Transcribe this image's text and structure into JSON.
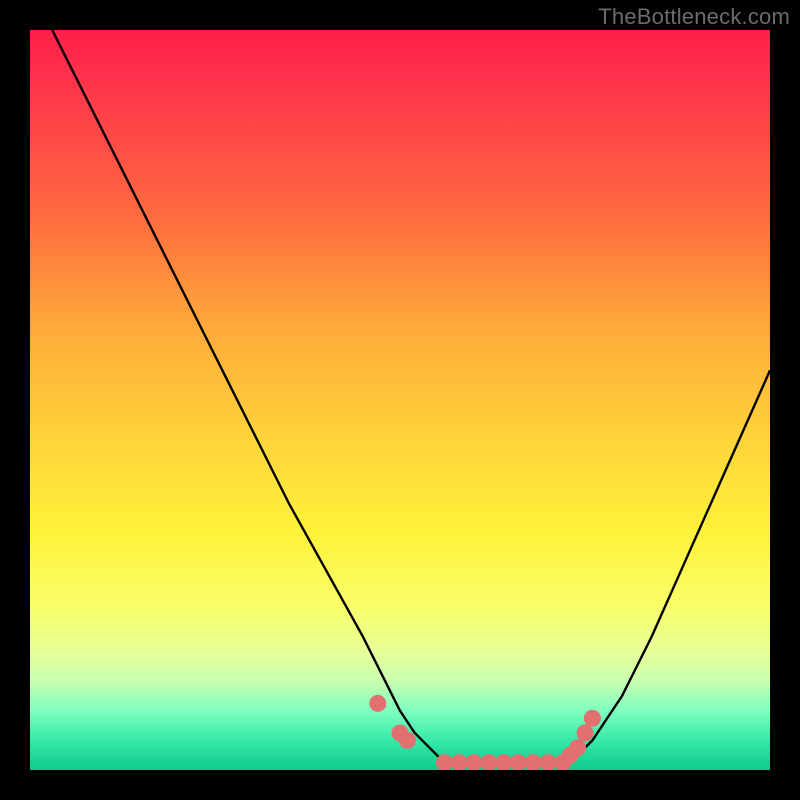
{
  "watermark": "TheBottleneck.com",
  "colors": {
    "background": "#000000",
    "curve_stroke": "#000000",
    "marker_fill": "#e27070",
    "marker_stroke": "#e27070"
  },
  "chart_data": {
    "type": "line",
    "title": "",
    "xlabel": "",
    "ylabel": "",
    "xlim": [
      0,
      100
    ],
    "ylim": [
      0,
      100
    ],
    "grid": false,
    "annotations": [
      "TheBottleneck.com"
    ],
    "series": [
      {
        "name": "bottleneck-curve-left",
        "x": [
          3,
          6,
          10,
          15,
          20,
          25,
          30,
          35,
          40,
          45,
          48,
          50,
          52,
          54,
          56
        ],
        "y": [
          100,
          94,
          86,
          76,
          66,
          56,
          46,
          36,
          27,
          18,
          12,
          8,
          5,
          3,
          1
        ]
      },
      {
        "name": "bottleneck-curve-right",
        "x": [
          73,
          76,
          80,
          84,
          88,
          92,
          96,
          100
        ],
        "y": [
          1,
          4,
          10,
          18,
          27,
          36,
          45,
          54
        ]
      }
    ],
    "flat_segment": {
      "x_start": 56,
      "x_end": 73,
      "y": 1
    },
    "markers": {
      "name": "highlighted-points",
      "points": [
        {
          "x": 47,
          "y": 9
        },
        {
          "x": 50,
          "y": 5
        },
        {
          "x": 51,
          "y": 4
        },
        {
          "x": 56,
          "y": 1
        },
        {
          "x": 58,
          "y": 1
        },
        {
          "x": 60,
          "y": 1
        },
        {
          "x": 62,
          "y": 1
        },
        {
          "x": 64,
          "y": 1
        },
        {
          "x": 66,
          "y": 1
        },
        {
          "x": 68,
          "y": 1
        },
        {
          "x": 70,
          "y": 1
        },
        {
          "x": 72,
          "y": 1
        },
        {
          "x": 73,
          "y": 2
        },
        {
          "x": 74,
          "y": 3
        },
        {
          "x": 75,
          "y": 5
        },
        {
          "x": 76,
          "y": 7
        }
      ]
    }
  }
}
